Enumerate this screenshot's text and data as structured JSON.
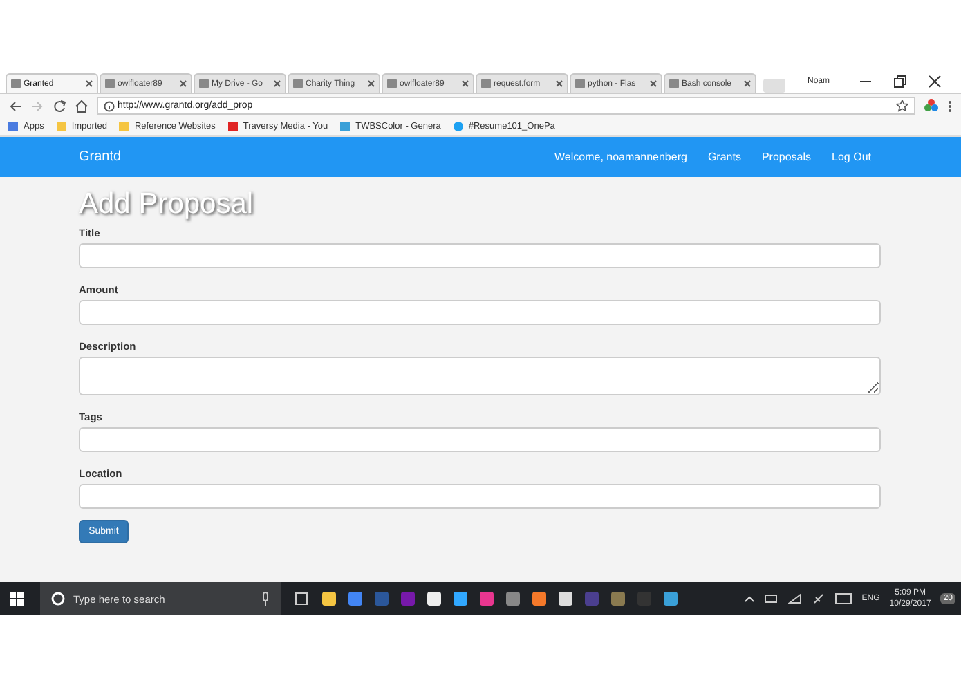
{
  "browser": {
    "tabs": [
      {
        "label": "Granted",
        "selected": true
      },
      {
        "label": "owlfloater89",
        "selected": false
      },
      {
        "label": "My Drive - Go",
        "selected": false
      },
      {
        "label": "Charity Thing",
        "selected": false
      },
      {
        "label": "owlfloater89",
        "selected": false
      },
      {
        "label": "request.form",
        "selected": false
      },
      {
        "label": "python - Flas",
        "selected": false
      },
      {
        "label": "Bash console",
        "selected": false
      }
    ],
    "user": "Noam",
    "url": "http://www.grantd.org/add_prop",
    "bookmarks": [
      "Apps",
      "Imported",
      "Reference Websites",
      "Traversy Media - You",
      "TWBSColor - Genera",
      "#Resume101_OnePa"
    ]
  },
  "navbar": {
    "brand": "Grantd",
    "links": [
      "Welcome, noamannenberg",
      "Grants",
      "Proposals",
      "Log Out"
    ]
  },
  "page": {
    "heading": "Add Proposal",
    "fields": [
      {
        "label": "Title",
        "kind": "input"
      },
      {
        "label": "Amount",
        "kind": "input"
      },
      {
        "label": "Description",
        "kind": "textarea"
      },
      {
        "label": "Tags",
        "kind": "input"
      },
      {
        "label": "Location",
        "kind": "input"
      }
    ],
    "submit": "Submit"
  },
  "taskbar": {
    "search_placeholder": "Type here to search",
    "language": "ENG",
    "time": "5:09 PM",
    "date": "10/29/2017",
    "notifications": "20"
  }
}
